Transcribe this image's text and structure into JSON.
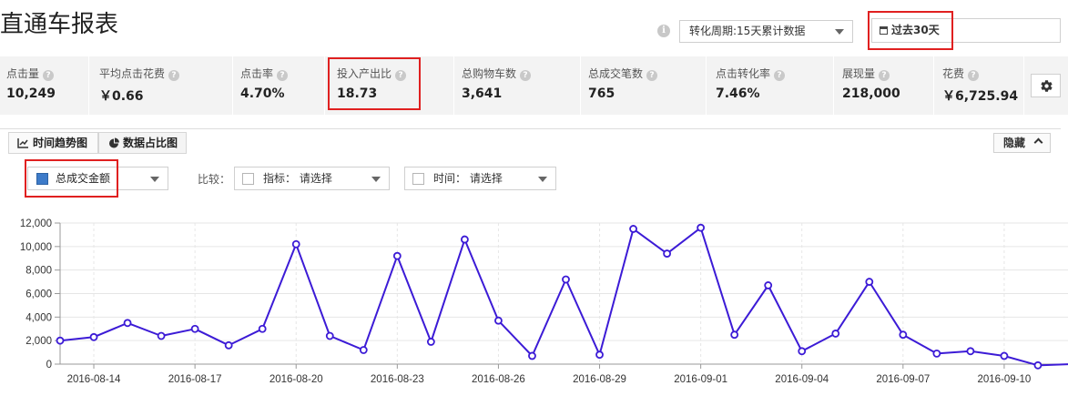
{
  "header": {
    "title": "直通车报表",
    "info_icon": "i",
    "period_label": "转化周期:15天累计数据",
    "range_label": "过去30天"
  },
  "metrics": [
    {
      "label": "点击量",
      "value": "10,249"
    },
    {
      "label": "平均点击花费",
      "value": "￥0.66"
    },
    {
      "label": "点击率",
      "value": "4.70%"
    },
    {
      "label": "投入产出比",
      "value": "18.73"
    },
    {
      "label": "总购物车数",
      "value": "3,641"
    },
    {
      "label": "总成交笔数",
      "value": "765"
    },
    {
      "label": "点击转化率",
      "value": "7.46%"
    },
    {
      "label": "展现量",
      "value": "218,000"
    },
    {
      "label": "花费",
      "value": "￥6,725.94"
    }
  ],
  "help_glyph": "?",
  "tabs": {
    "trend": "时间趋势图",
    "share": "数据占比图"
  },
  "hide_label": "隐藏",
  "controls": {
    "metric_select": "总成交金额",
    "compare_label": "比较：",
    "indicator_select": "指标： 请选择",
    "time_select": "时间： 请选择"
  },
  "colors": {
    "line": "#3c1bd6",
    "swatch": "#3d7bc9",
    "highlight": "#e02020",
    "metric_bg": "#f3f3f3"
  },
  "icons": {
    "info": "info-icon",
    "calendar": "calendar-icon",
    "gear": "gear-icon",
    "trend_tab": "line-chart-icon",
    "share_tab": "pie-chart-icon",
    "hide": "chevron-up-icon"
  },
  "chart_data": {
    "type": "line",
    "x": [
      "2016-08-13",
      "2016-08-14",
      "2016-08-15",
      "2016-08-16",
      "2016-08-17",
      "2016-08-18",
      "2016-08-19",
      "2016-08-20",
      "2016-08-21",
      "2016-08-22",
      "2016-08-23",
      "2016-08-24",
      "2016-08-25",
      "2016-08-26",
      "2016-08-27",
      "2016-08-28",
      "2016-08-29",
      "2016-08-30",
      "2016-08-31",
      "2016-09-01",
      "2016-09-02",
      "2016-09-03",
      "2016-09-04",
      "2016-09-05",
      "2016-09-06",
      "2016-09-07",
      "2016-09-08",
      "2016-09-09",
      "2016-09-10",
      "2016-09-11",
      "2016-09-12"
    ],
    "xticks": [
      "2016-08-14",
      "2016-08-17",
      "2016-08-20",
      "2016-08-23",
      "2016-08-26",
      "2016-08-29",
      "2016-09-01",
      "2016-09-04",
      "2016-09-07",
      "2016-09-10"
    ],
    "series": [
      {
        "values": [
          2000,
          2300,
          3500,
          2400,
          3000,
          1600,
          3000,
          10200,
          2400,
          1200,
          9200,
          1900,
          10600,
          3700,
          700,
          7200,
          800,
          11500,
          9400,
          11600,
          2500,
          6700,
          1100,
          2600,
          7000,
          2500,
          900,
          1100,
          700,
          -100,
          0
        ]
      }
    ],
    "ylim": [
      0,
      12000
    ],
    "yticks": [
      0,
      2000,
      4000,
      6000,
      8000,
      10000,
      12000
    ],
    "ytick_labels": [
      "0",
      "2,000",
      "4,000",
      "6,000",
      "8,000",
      "10,000",
      "12,000"
    ],
    "grid": true,
    "legend": "none",
    "title": "",
    "xlabel": "",
    "ylabel": ""
  }
}
